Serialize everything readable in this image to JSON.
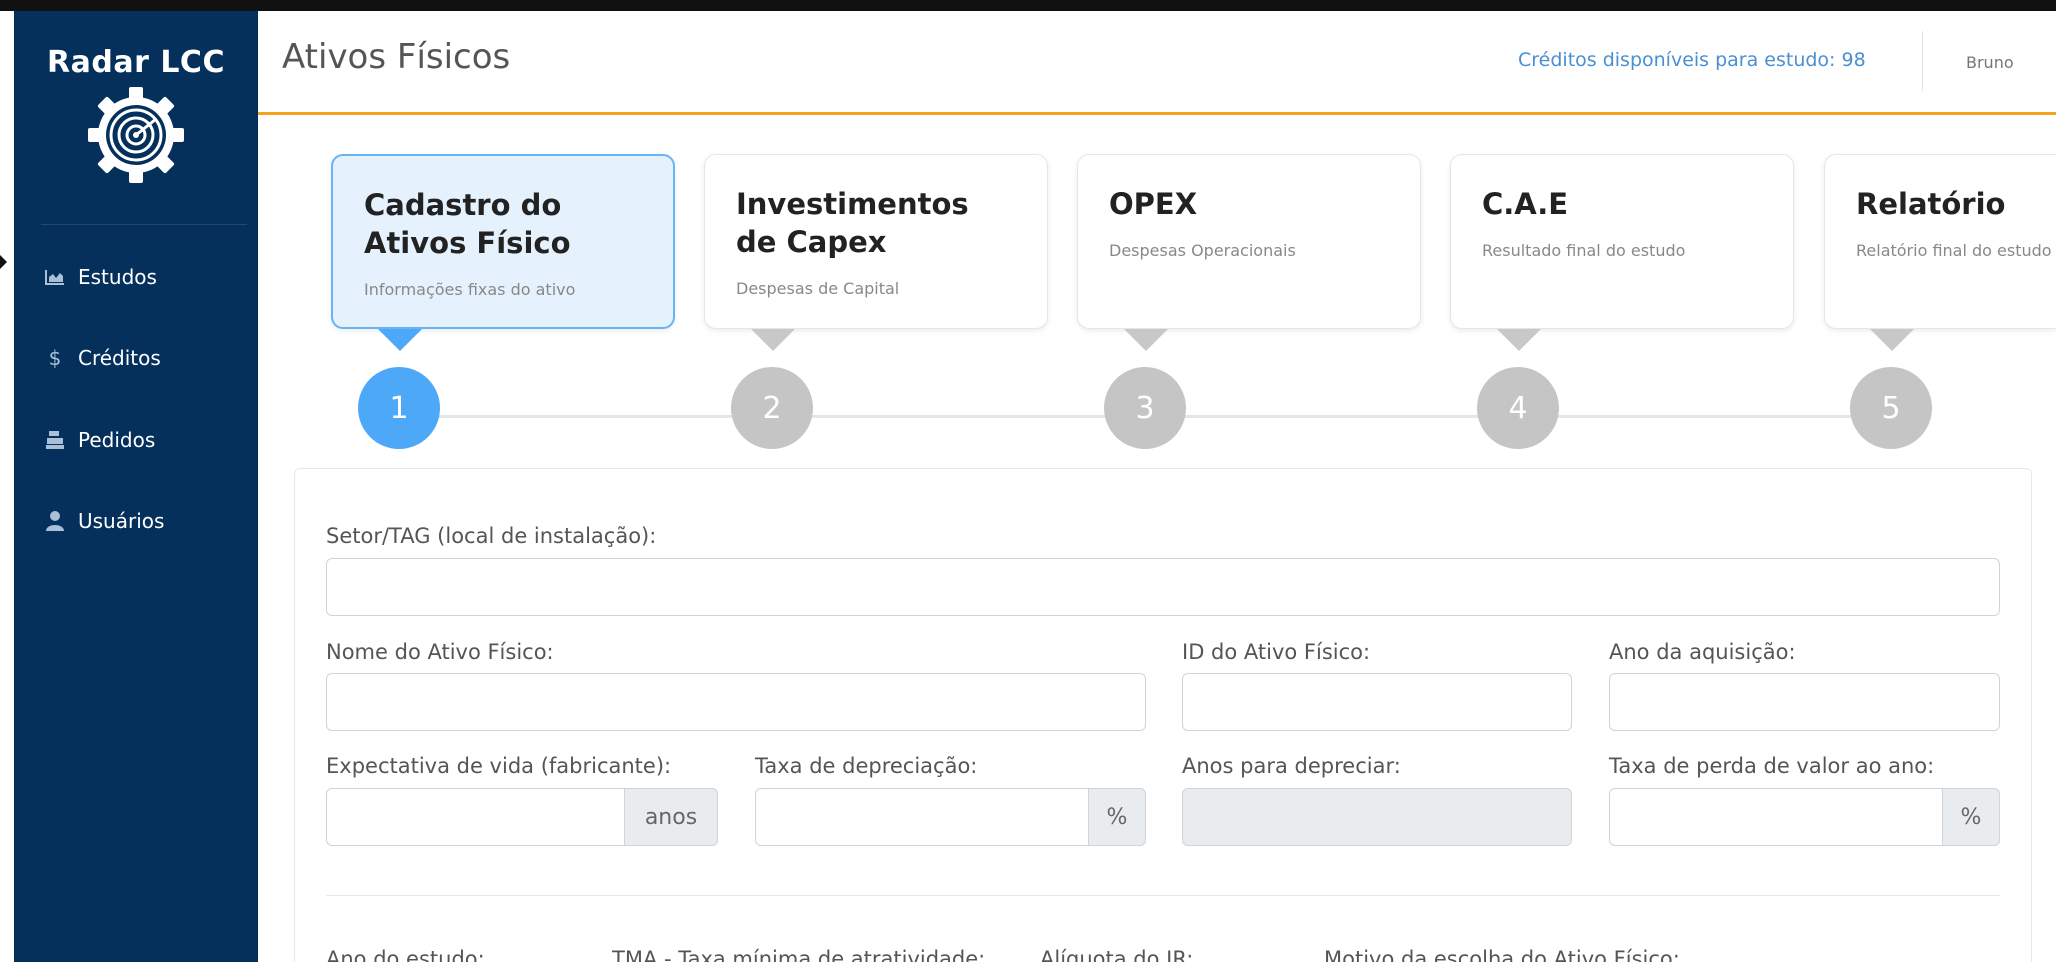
{
  "sidebar": {
    "brand": "Radar LCC",
    "logo_icon": "radar-gear-icon",
    "items": [
      {
        "label": "Estudos",
        "icon": "chart-area-icon"
      },
      {
        "label": "Créditos",
        "icon": "dollar-icon"
      },
      {
        "label": "Pedidos",
        "icon": "cash-register-icon"
      },
      {
        "label": "Usuários",
        "icon": "user-icon"
      }
    ],
    "bg_color": "#05305c"
  },
  "header": {
    "title": "Ativos Físicos",
    "credits": "Créditos disponíveis para estudo: 98",
    "user": "Bruno",
    "accent_color": "#f4a41c"
  },
  "steps": [
    {
      "number": "1",
      "title": "Cadastro do Ativos Físico",
      "subtitle": "Informações fixas do ativo",
      "active": true
    },
    {
      "number": "2",
      "title": "Investimentos de Capex",
      "subtitle": "Despesas de Capital",
      "active": false
    },
    {
      "number": "3",
      "title": "OPEX",
      "subtitle": "Despesas Operacionais",
      "active": false
    },
    {
      "number": "4",
      "title": "C.A.E",
      "subtitle": "Resultado final do estudo",
      "active": false
    },
    {
      "number": "5",
      "title": "Relatório",
      "subtitle": "Relatório final do estudo",
      "active": false
    }
  ],
  "form": {
    "setor_label": "Setor/TAG (local de instalação):",
    "setor_value": "",
    "nome_label": "Nome do Ativo Físico:",
    "nome_value": "",
    "id_label": "ID do Ativo Físico:",
    "id_value": "",
    "ano_aquisicao_label": "Ano da aquisição:",
    "ano_aquisicao_value": "",
    "expectativa_label": "Expectativa de vida (fabricante):",
    "expectativa_value": "",
    "expectativa_unit": "anos",
    "taxa_depreciacao_label": "Taxa de depreciação:",
    "taxa_depreciacao_value": "",
    "taxa_depreciacao_unit": "%",
    "anos_depreciar_label": "Anos para depreciar:",
    "anos_depreciar_value": "",
    "taxa_perda_label": "Taxa de perda de valor ao ano:",
    "taxa_perda_value": "",
    "taxa_perda_unit": "%",
    "ano_estudo_label": "Ano do estudo:",
    "tma_label": "TMA - Taxa mínima de atratividade:",
    "aliquota_label": "Alíquota do IR:",
    "motivo_label": "Motivo da escolha do Ativo Físico:"
  },
  "colors": {
    "active_step": "#4da8f7",
    "inactive_step": "#c5c5c5",
    "active_card_bg": "#e5f2fd",
    "link_blue": "#4a8fd4"
  }
}
